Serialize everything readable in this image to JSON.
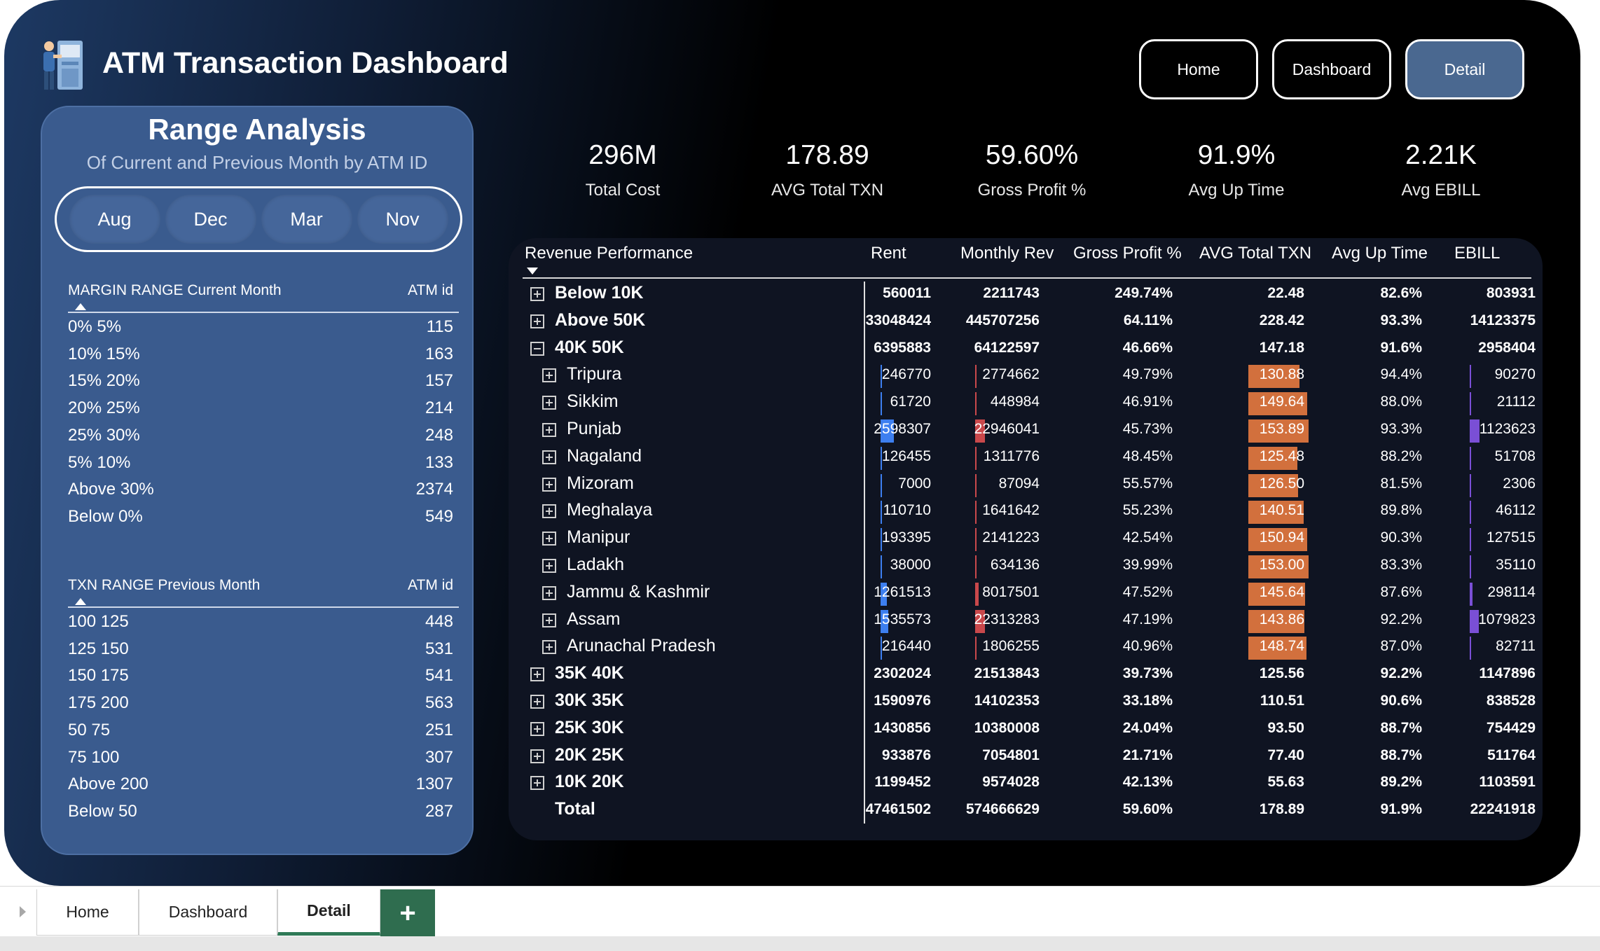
{
  "header": {
    "title": "ATM Transaction Dashboard",
    "nav": [
      "Home",
      "Dashboard",
      "Detail"
    ],
    "active_nav": "Detail"
  },
  "range_panel": {
    "title": "Range Analysis",
    "subtitle": "Of Current and Previous Month by ATM ID",
    "months": [
      "Aug",
      "Dec",
      "Mar",
      "Nov"
    ],
    "margin_table": {
      "header": "MARGIN RANGE Current Month",
      "value_header": "ATM id",
      "rows": [
        {
          "label": "0% 5%",
          "value": "115"
        },
        {
          "label": "10% 15%",
          "value": "163"
        },
        {
          "label": "15% 20%",
          "value": "157"
        },
        {
          "label": "20% 25%",
          "value": "214"
        },
        {
          "label": "25% 30%",
          "value": "248"
        },
        {
          "label": "5% 10%",
          "value": "133"
        },
        {
          "label": "Above 30%",
          "value": "2374"
        },
        {
          "label": "Below 0%",
          "value": "549"
        }
      ]
    },
    "txn_table": {
      "header": "TXN RANGE Previous Month",
      "value_header": "ATM id",
      "rows": [
        {
          "label": "100 125",
          "value": "448"
        },
        {
          "label": "125 150",
          "value": "531"
        },
        {
          "label": "150 175",
          "value": "541"
        },
        {
          "label": "175 200",
          "value": "563"
        },
        {
          "label": "50 75",
          "value": "251"
        },
        {
          "label": "75 100",
          "value": "307"
        },
        {
          "label": "Above 200",
          "value": "1307"
        },
        {
          "label": "Below 50",
          "value": "287"
        }
      ]
    }
  },
  "kpis": [
    {
      "value": "296M",
      "label": "Total Cost"
    },
    {
      "value": "178.89",
      "label": "AVG Total TXN"
    },
    {
      "value": "59.60%",
      "label": "Gross Profit %"
    },
    {
      "value": "91.9%",
      "label": "Avg Up Time"
    },
    {
      "value": "2.21K",
      "label": "Avg EBILL"
    }
  ],
  "matrix": {
    "columns": [
      "Revenue Performance",
      "Rent",
      "Monthly Rev",
      "Gross Profit %",
      "AVG Total TXN",
      "Avg Up Time",
      "EBILL"
    ],
    "rows": [
      {
        "label": "Below 10K",
        "level": 0,
        "expander": "plus",
        "cells": [
          "560011",
          "2211743",
          "249.74%",
          "22.48",
          "82.6%",
          "803931"
        ]
      },
      {
        "label": "Above 50K",
        "level": 0,
        "expander": "plus",
        "cells": [
          "33048424",
          "445707256",
          "64.11%",
          "228.42",
          "93.3%",
          "14123375"
        ]
      },
      {
        "label": "40K 50K",
        "level": 0,
        "expander": "minus",
        "cells": [
          "6395883",
          "64122597",
          "46.66%",
          "147.18",
          "91.6%",
          "2958404"
        ]
      },
      {
        "label": "Tripura",
        "level": 1,
        "expander": "plus",
        "cells": [
          "246770",
          "2774662",
          "49.79%",
          "130.88",
          "94.4%",
          "90270"
        ]
      },
      {
        "label": "Sikkim",
        "level": 1,
        "expander": "plus",
        "cells": [
          "61720",
          "448984",
          "46.91%",
          "149.64",
          "88.0%",
          "21112"
        ]
      },
      {
        "label": "Punjab",
        "level": 1,
        "expander": "plus",
        "cells": [
          "2598307",
          "22946041",
          "45.73%",
          "153.89",
          "93.3%",
          "1123623"
        ]
      },
      {
        "label": "Nagaland",
        "level": 1,
        "expander": "plus",
        "cells": [
          "126455",
          "1311776",
          "48.45%",
          "125.48",
          "88.2%",
          "51708"
        ]
      },
      {
        "label": "Mizoram",
        "level": 1,
        "expander": "plus",
        "cells": [
          "7000",
          "87094",
          "55.57%",
          "126.50",
          "81.5%",
          "2306"
        ]
      },
      {
        "label": "Meghalaya",
        "level": 1,
        "expander": "plus",
        "cells": [
          "110710",
          "1641642",
          "55.23%",
          "140.51",
          "89.8%",
          "46112"
        ]
      },
      {
        "label": "Manipur",
        "level": 1,
        "expander": "plus",
        "cells": [
          "193395",
          "2141223",
          "42.54%",
          "150.94",
          "90.3%",
          "127515"
        ]
      },
      {
        "label": "Ladakh",
        "level": 1,
        "expander": "plus",
        "cells": [
          "38000",
          "634136",
          "39.99%",
          "153.00",
          "83.3%",
          "35110"
        ]
      },
      {
        "label": "Jammu & Kashmir",
        "level": 1,
        "expander": "plus",
        "cells": [
          "1261513",
          "8017501",
          "47.52%",
          "145.64",
          "87.6%",
          "298114"
        ]
      },
      {
        "label": "Assam",
        "level": 1,
        "expander": "plus",
        "cells": [
          "1535573",
          "22313283",
          "47.19%",
          "143.86",
          "92.2%",
          "1079823"
        ]
      },
      {
        "label": "Arunachal Pradesh",
        "level": 1,
        "expander": "plus",
        "cells": [
          "216440",
          "1806255",
          "40.96%",
          "148.74",
          "87.0%",
          "82711"
        ]
      },
      {
        "label": "35K 40K",
        "level": 0,
        "expander": "plus",
        "cells": [
          "2302024",
          "21513843",
          "39.73%",
          "125.56",
          "92.2%",
          "1147896"
        ]
      },
      {
        "label": "30K 35K",
        "level": 0,
        "expander": "plus",
        "cells": [
          "1590976",
          "14102353",
          "33.18%",
          "110.51",
          "90.6%",
          "838528"
        ]
      },
      {
        "label": "25K 30K",
        "level": 0,
        "expander": "plus",
        "cells": [
          "1430856",
          "10380008",
          "24.04%",
          "93.50",
          "88.7%",
          "754429"
        ]
      },
      {
        "label": "20K 25K",
        "level": 0,
        "expander": "plus",
        "cells": [
          "933876",
          "7054801",
          "21.71%",
          "77.40",
          "88.7%",
          "511764"
        ]
      },
      {
        "label": "10K 20K",
        "level": 0,
        "expander": "plus",
        "cells": [
          "1199452",
          "9574028",
          "42.13%",
          "55.63",
          "89.2%",
          "1103591"
        ]
      },
      {
        "label": "Total",
        "level": 0,
        "expander": "none",
        "cells": [
          "47461502",
          "574666629",
          "59.60%",
          "178.89",
          "91.9%",
          "22241918"
        ]
      }
    ],
    "databar_colors": {
      "rent": "#3d7ff0",
      "monthly_rev": "#c9484b",
      "avg_txn": "#d2703d",
      "ebill": "#7a4fd6"
    }
  },
  "sheet_tabs": {
    "tabs": [
      "Home",
      "Dashboard",
      "Detail"
    ],
    "active": "Detail",
    "add_label": "+"
  }
}
